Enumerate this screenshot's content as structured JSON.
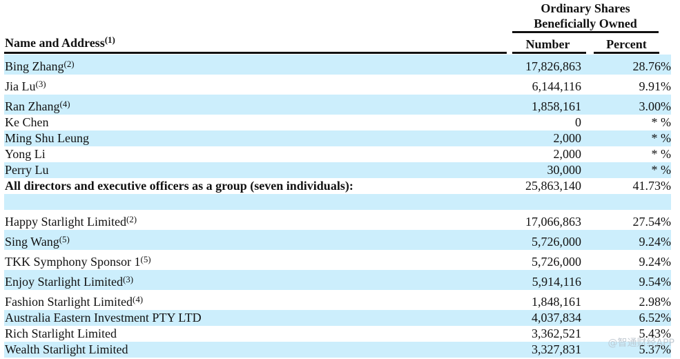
{
  "header": {
    "group_line1": "Ordinary Shares",
    "group_line2": "Beneficially Owned",
    "name_label": "Name and Address",
    "name_note": "(1)",
    "number_label": "Number",
    "percent_label": "Percent"
  },
  "rows": [
    {
      "name": "Bing Zhang",
      "note": "(2)",
      "number": "17,826,863",
      "percent": "28.76%",
      "shaded": true
    },
    {
      "name": "Jia Lu",
      "note": "(3)",
      "number": "6,144,116",
      "percent": "9.91%",
      "shaded": false
    },
    {
      "name": "Ran Zhang",
      "note": "(4)",
      "number": "1,858,161",
      "percent": "3.00%",
      "shaded": true
    },
    {
      "name": "Ke Chen",
      "note": "",
      "number": "0",
      "percent": "* %",
      "shaded": false
    },
    {
      "name": "Ming Shu Leung",
      "note": "",
      "number": "2,000",
      "percent": "* %",
      "shaded": true
    },
    {
      "name": "Yong Li",
      "note": "",
      "number": "2,000",
      "percent": "* %",
      "shaded": false
    },
    {
      "name": "Perry Lu",
      "note": "",
      "number": "30,000",
      "percent": "* %",
      "shaded": true
    },
    {
      "name": "All directors and executive officers as a group (seven individuals):",
      "note": "",
      "number": "25,863,140",
      "percent": "41.73%",
      "shaded": false,
      "bold": true
    },
    {
      "name": "",
      "note": "",
      "number": "",
      "percent": "",
      "shaded": true
    },
    {
      "name": "Happy Starlight Limited",
      "note": "(2)",
      "number": "17,066,863",
      "percent": "27.54%",
      "shaded": false
    },
    {
      "name": "Sing Wang",
      "note": "(5)",
      "number": "5,726,000",
      "percent": "9.24%",
      "shaded": true
    },
    {
      "name": "TKK Symphony Sponsor 1",
      "note": "(5)",
      "number": "5,726,000",
      "percent": "9.24%",
      "shaded": false
    },
    {
      "name": "Enjoy Starlight Limited",
      "note": "(3)",
      "number": "5,914,116",
      "percent": "9.54%",
      "shaded": true
    },
    {
      "name": "Fashion Starlight Limited",
      "note": "(4)",
      "number": "1,848,161",
      "percent": "2.98%",
      "shaded": false
    },
    {
      "name": "Australia Eastern Investment PTY LTD",
      "note": "",
      "number": "4,037,834",
      "percent": "6.52%",
      "shaded": true
    },
    {
      "name": "Rich Starlight Limited",
      "note": "",
      "number": "3,362,521",
      "percent": "5.43%",
      "shaded": false
    },
    {
      "name": "Wealth Starlight Limited",
      "note": "",
      "number": "3,327,831",
      "percent": "5.37%",
      "shaded": true
    }
  ],
  "watermark": "@智通财经APP",
  "colors": {
    "row_shade": "#cceefc",
    "text": "#111111"
  }
}
